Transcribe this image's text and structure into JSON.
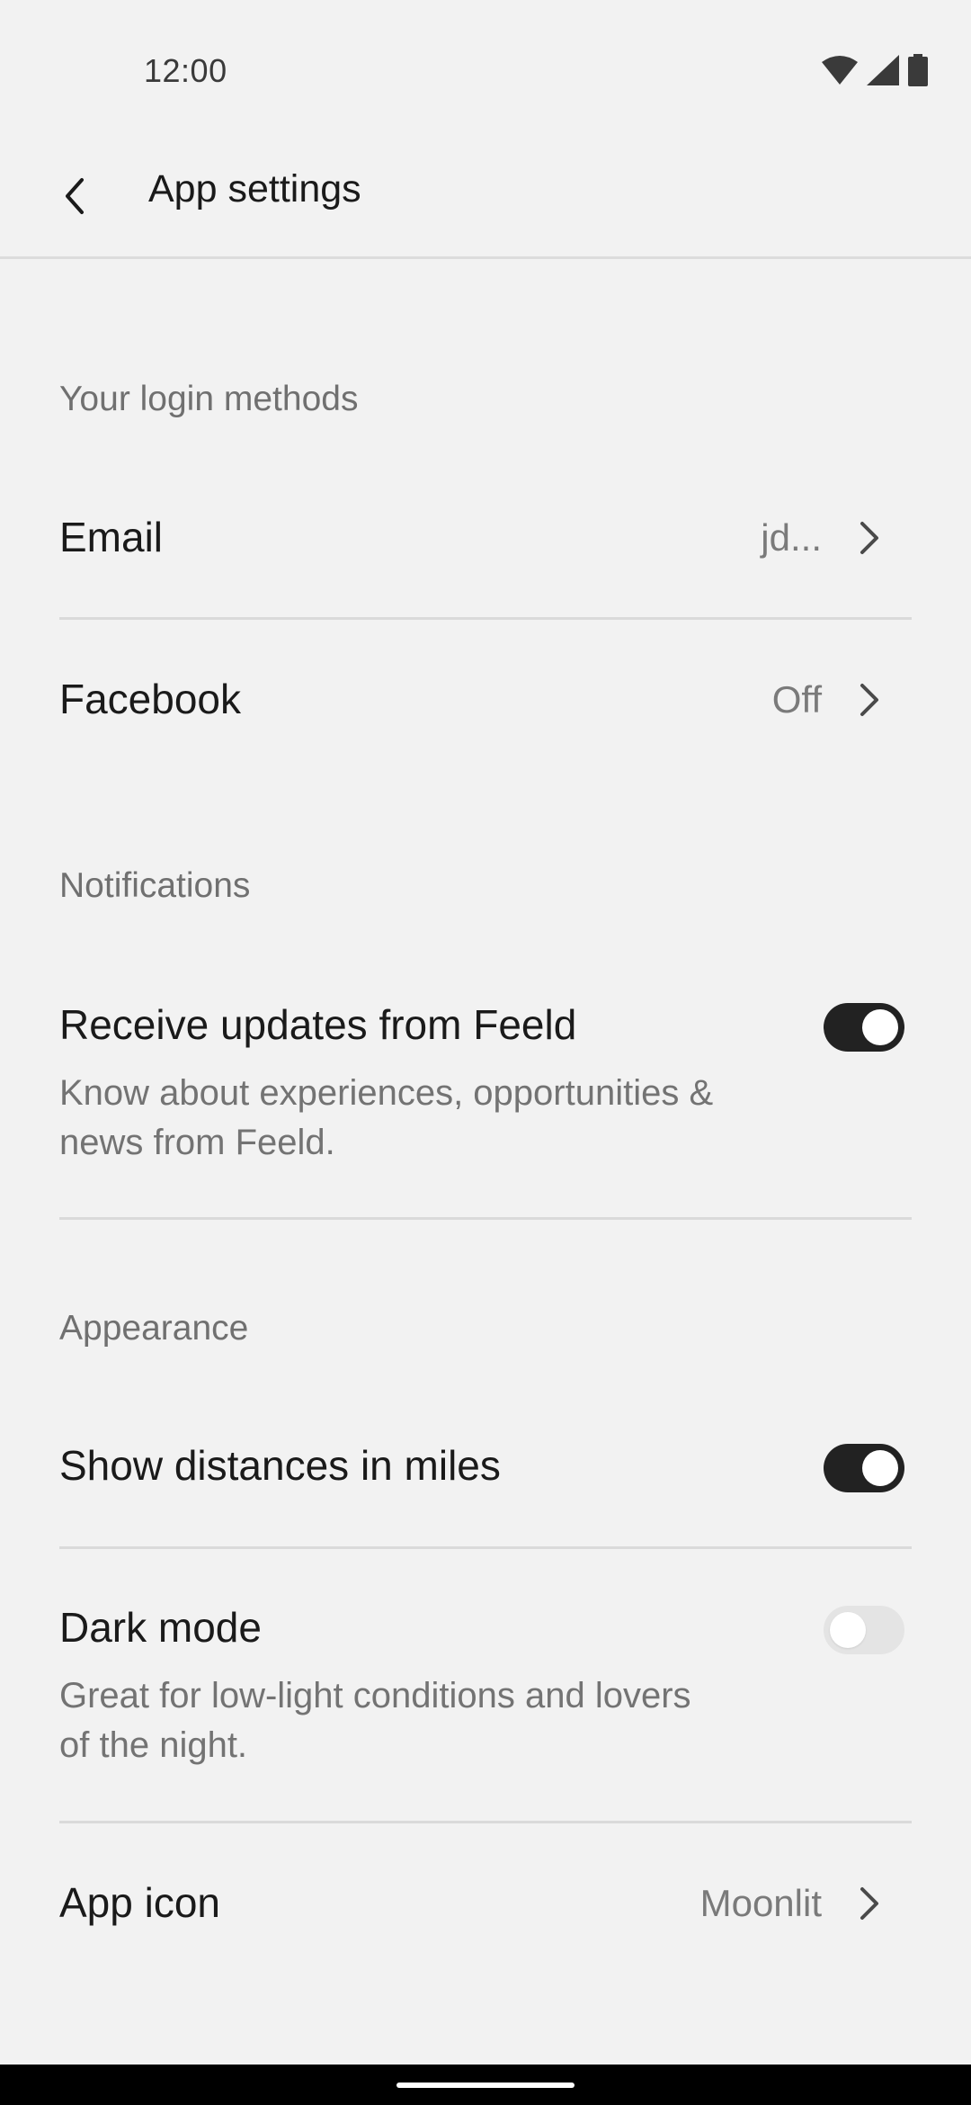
{
  "status_bar": {
    "time": "12:00",
    "icons": [
      "wifi-icon",
      "signal-icon",
      "battery-icon"
    ]
  },
  "app_bar": {
    "back_icon": "chevron-left-icon",
    "title": "App settings"
  },
  "sections": {
    "login": {
      "header": "Your login methods",
      "email": {
        "label": "Email",
        "value": "jd..."
      },
      "facebook": {
        "label": "Facebook",
        "value": "Off"
      }
    },
    "notifications": {
      "header": "Notifications",
      "updates": {
        "label": "Receive updates from Feeld",
        "description": "Know about experiences, opportunities & news from Feeld.",
        "enabled": true
      }
    },
    "appearance": {
      "header": "Appearance",
      "miles": {
        "label": "Show distances in miles",
        "enabled": true
      },
      "dark_mode": {
        "label": "Dark mode",
        "description": "Great for low-light conditions and lovers of the night.",
        "enabled": false
      },
      "app_icon": {
        "label": "App icon",
        "value": "Moonlit"
      }
    }
  },
  "colors": {
    "background": "#f2f2f2",
    "toggle_on": "#222222",
    "toggle_off": "#e4e4e4",
    "secondary_text": "#737373"
  }
}
